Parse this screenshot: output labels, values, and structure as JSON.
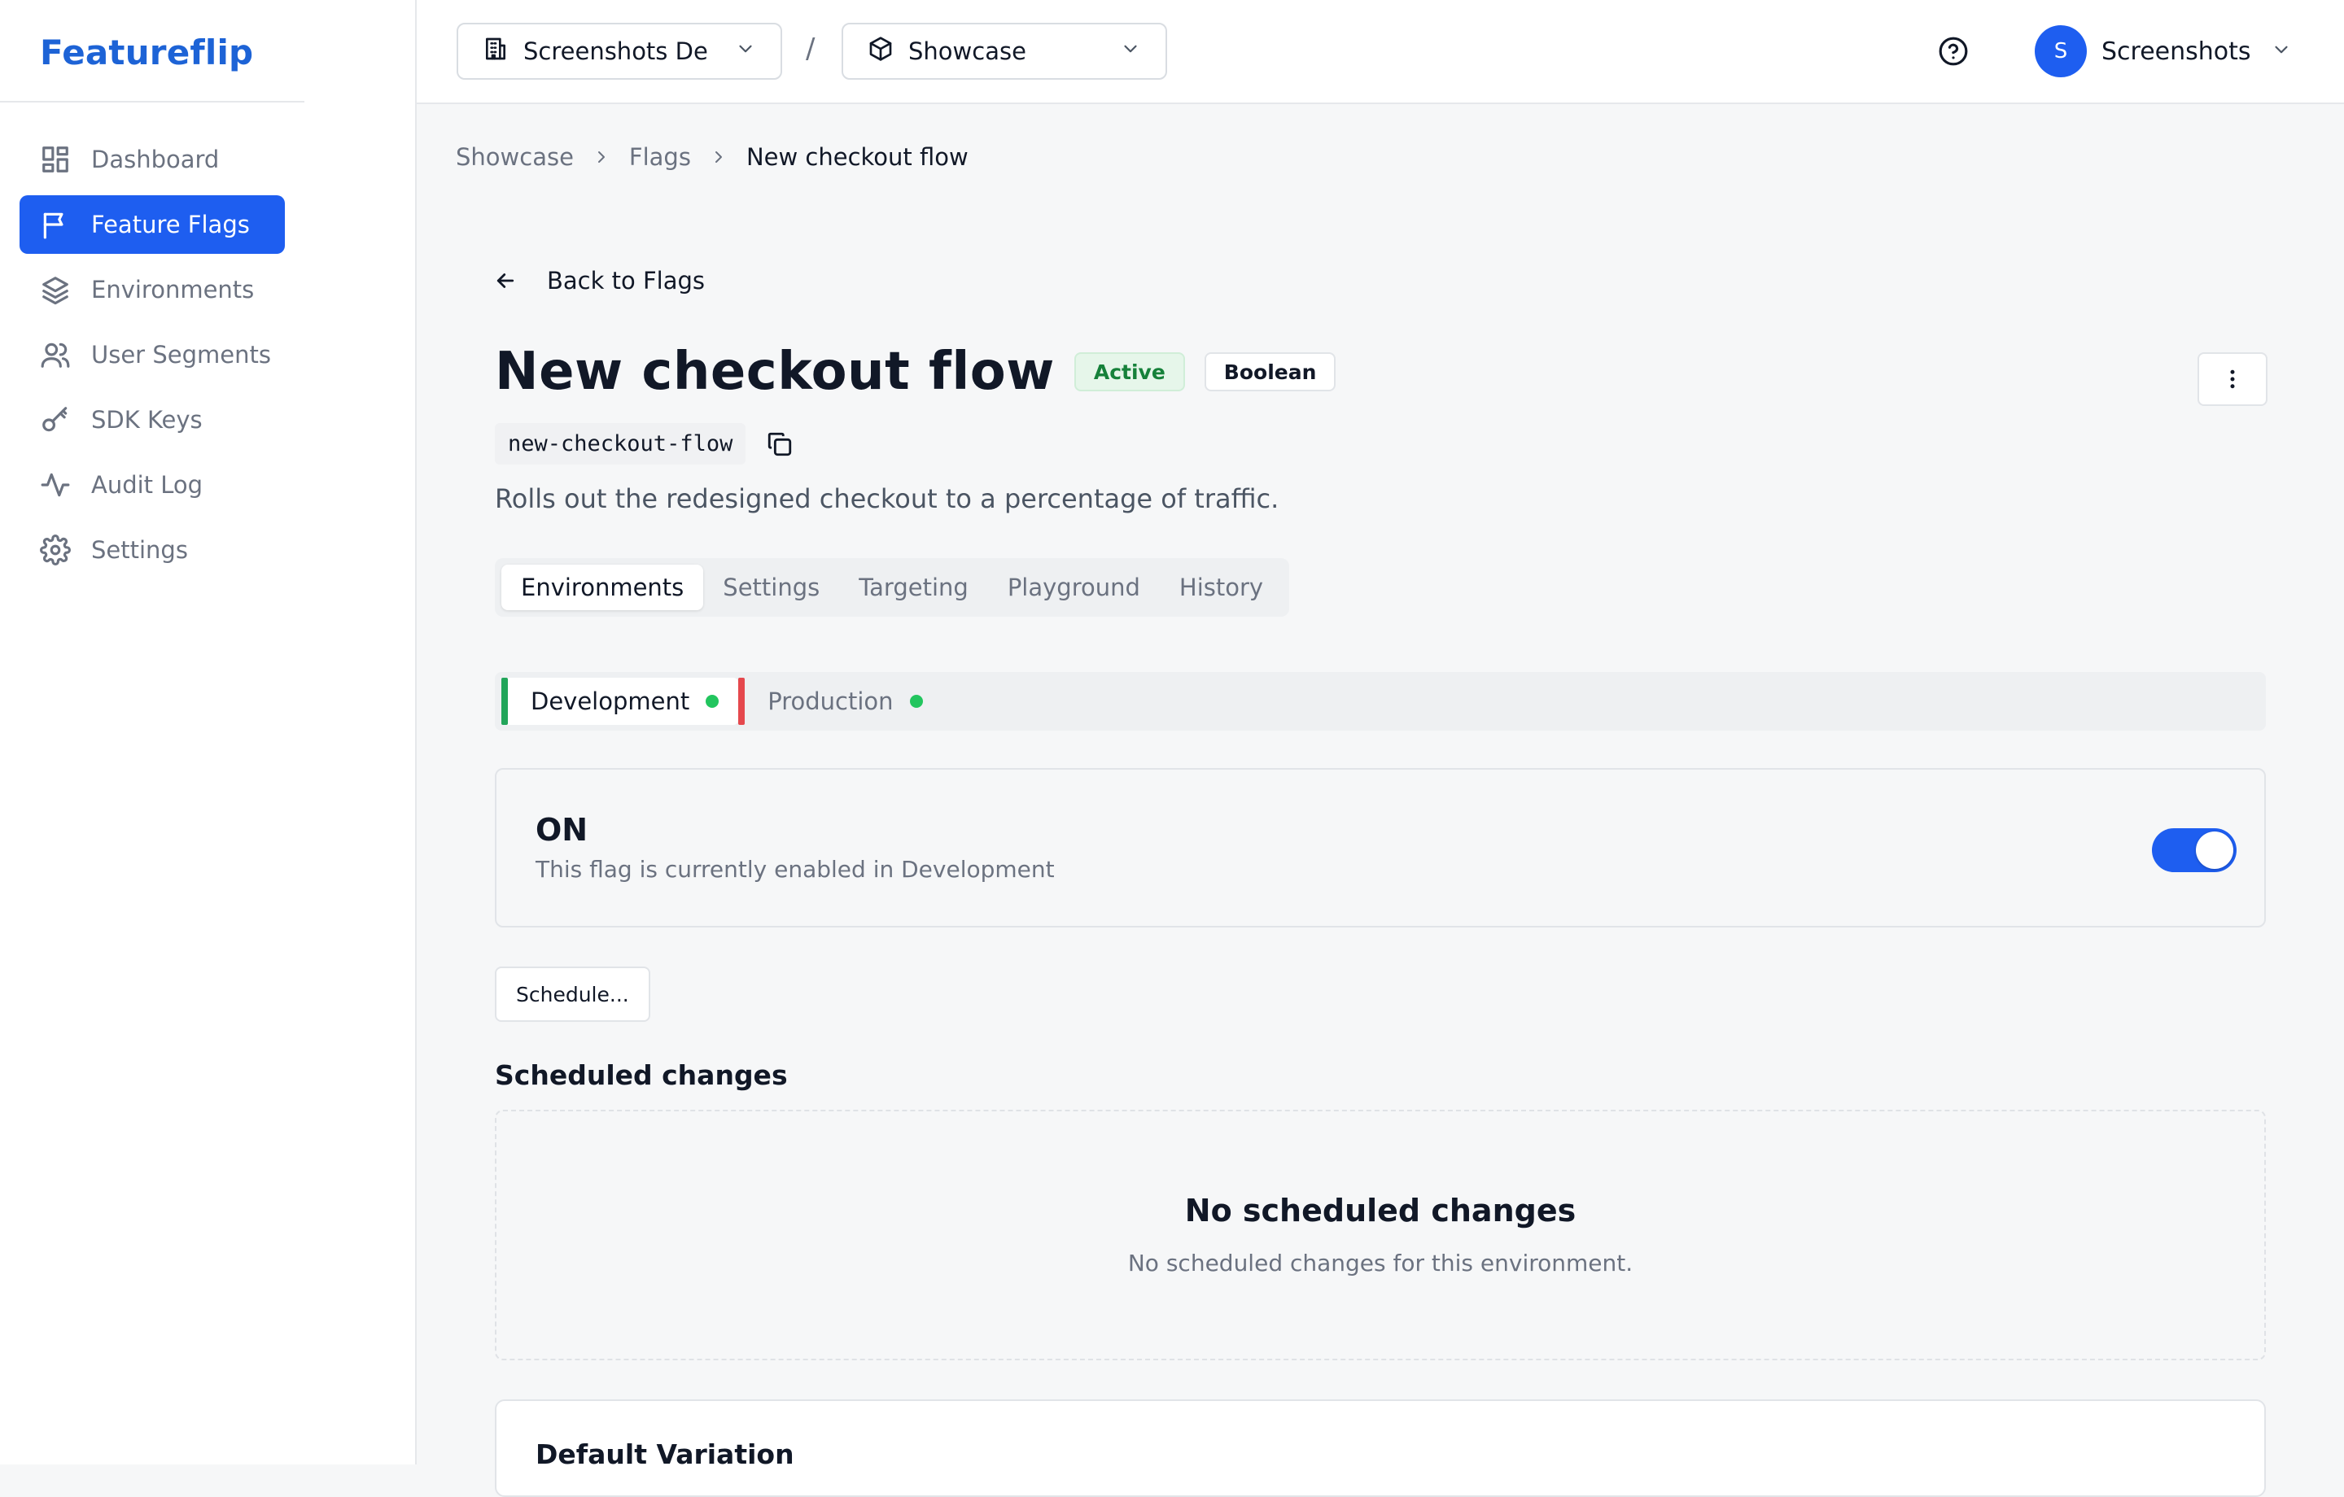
{
  "app": {
    "brand": "Featureflip"
  },
  "sidebar": {
    "items": [
      {
        "label": "Dashboard",
        "icon": "dashboard-icon",
        "active": false
      },
      {
        "label": "Feature Flags",
        "icon": "flag-icon",
        "active": true
      },
      {
        "label": "Environments",
        "icon": "layers-icon",
        "active": false
      },
      {
        "label": "User Segments",
        "icon": "users-icon",
        "active": false
      },
      {
        "label": "SDK Keys",
        "icon": "key-icon",
        "active": false
      },
      {
        "label": "Audit Log",
        "icon": "activity-icon",
        "active": false
      },
      {
        "label": "Settings",
        "icon": "gear-icon",
        "active": false
      }
    ]
  },
  "header": {
    "org_selector": "Screenshots De",
    "separator": "/",
    "project_selector": "Showcase",
    "user": {
      "initial": "S",
      "name": "Screenshots"
    }
  },
  "breadcrumb": [
    "Showcase",
    "Flags",
    "New checkout flow"
  ],
  "flag": {
    "back_label": "Back to Flags",
    "name": "New checkout flow",
    "status_badge": "Active",
    "type_badge": "Boolean",
    "key": "new-checkout-flow",
    "description": "Rolls out the redesigned checkout to a percentage of traffic."
  },
  "tabs": [
    {
      "label": "Environments",
      "active": true
    },
    {
      "label": "Settings",
      "active": false
    },
    {
      "label": "Targeting",
      "active": false
    },
    {
      "label": "Playground",
      "active": false
    },
    {
      "label": "History",
      "active": false
    }
  ],
  "environments": [
    {
      "label": "Development",
      "active": true,
      "color": "#22a55a",
      "status_color": "#22c55e"
    },
    {
      "label": "Production",
      "active": false,
      "color": "#e5484d",
      "status_color": "#22c55e"
    }
  ],
  "status": {
    "state": "ON",
    "message": "This flag is currently enabled in Development",
    "enabled": true
  },
  "schedule_button": "Schedule...",
  "scheduled": {
    "title": "Scheduled changes",
    "empty_title": "No scheduled changes",
    "empty_message": "No scheduled changes for this environment."
  },
  "default_variation": {
    "title": "Default Variation"
  },
  "colors": {
    "accent": "#1e5ef0",
    "brand": "#1d63d6",
    "active_badge_bg": "#e6f6ea",
    "active_badge_text": "#16813a"
  }
}
